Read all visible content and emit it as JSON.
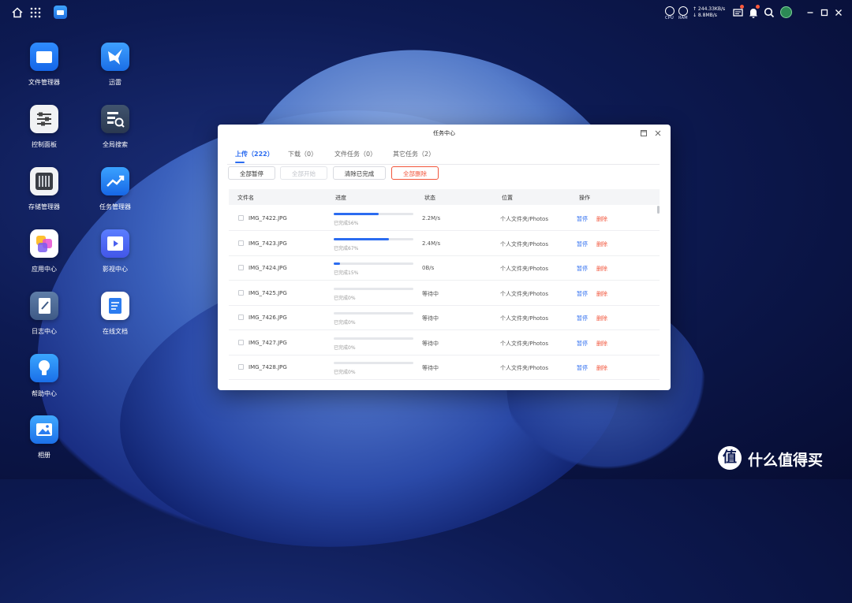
{
  "desktop": {
    "icons": [
      {
        "label": "文件管理器"
      },
      {
        "label": "迅雷"
      },
      {
        "label": "控制面板"
      },
      {
        "label": "全局搜索"
      },
      {
        "label": "存储管理器"
      },
      {
        "label": "任务管理器"
      },
      {
        "label": "应用中心"
      },
      {
        "label": "影视中心"
      },
      {
        "label": "日志中心"
      },
      {
        "label": "在线文档"
      },
      {
        "label": "帮助中心"
      },
      {
        "label": "相册"
      }
    ]
  },
  "topbar": {
    "cpu_label": "CPU",
    "ram_label": "RAM",
    "upload_speed": "↑ 244.33KB/s",
    "download_speed": "↓ 8.8MB/s"
  },
  "window": {
    "title": "任务中心",
    "tabs": [
      {
        "label": "上传（222）",
        "active": true
      },
      {
        "label": "下载（0）",
        "active": false
      },
      {
        "label": "文件任务（0）",
        "active": false
      },
      {
        "label": "其它任务（2）",
        "active": false
      }
    ],
    "buttons": {
      "pause_all": "全部暂停",
      "start_all": "全部开始",
      "clear_done": "清除已完成",
      "delete_all": "全部删除"
    },
    "columns": {
      "name": "文件名",
      "progress": "进度",
      "status": "状态",
      "location": "位置",
      "actions": "操作"
    },
    "rows": [
      {
        "name": "IMG_7422.JPG",
        "progress": 0.56,
        "progress_text": "已完成56%",
        "status": "2.2M/s",
        "location": "个人文件夹/Photos",
        "pause": "暂停",
        "delete": "删除"
      },
      {
        "name": "IMG_7423.JPG",
        "progress": 0.69,
        "progress_text": "已完成67%",
        "status": "2.4M/s",
        "location": "个人文件夹/Photos",
        "pause": "暂停",
        "delete": "删除"
      },
      {
        "name": "IMG_7424.JPG",
        "progress": 0.08,
        "progress_text": "已完成15%",
        "status": "0B/s",
        "location": "个人文件夹/Photos",
        "pause": "暂停",
        "delete": "删除"
      },
      {
        "name": "IMG_7425.JPG",
        "progress": 0,
        "progress_text": "已完成0%",
        "status": "等待中",
        "location": "个人文件夹/Photos",
        "pause": "暂停",
        "delete": "删除"
      },
      {
        "name": "IMG_7426.JPG",
        "progress": 0,
        "progress_text": "已完成0%",
        "status": "等待中",
        "location": "个人文件夹/Photos",
        "pause": "暂停",
        "delete": "删除"
      },
      {
        "name": "IMG_7427.JPG",
        "progress": 0,
        "progress_text": "已完成0%",
        "status": "等待中",
        "location": "个人文件夹/Photos",
        "pause": "暂停",
        "delete": "删除"
      },
      {
        "name": "IMG_7428.JPG",
        "progress": 0,
        "progress_text": "已完成0%",
        "status": "等待中",
        "location": "个人文件夹/Photos",
        "pause": "暂停",
        "delete": "删除"
      }
    ]
  },
  "watermark": {
    "symbol": "值",
    "text": "什么值得买"
  },
  "colors": {
    "accent": "#2b6cf0",
    "danger": "#f2553b"
  }
}
